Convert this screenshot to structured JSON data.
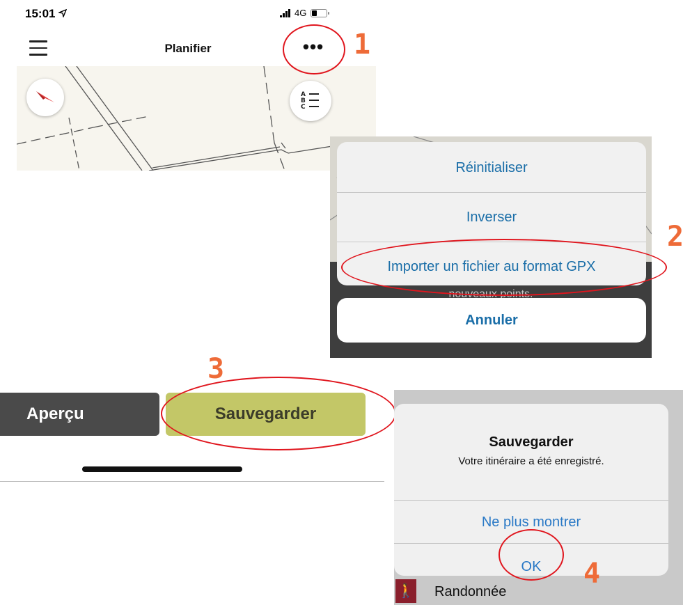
{
  "status_bar": {
    "time": "15:01",
    "network": "4G"
  },
  "header": {
    "title": "Planifier"
  },
  "action_sheet": {
    "items": [
      "Réinitialiser",
      "Inverser",
      "Importer un fichier au format GPX"
    ],
    "behind_text": "nouveaux points.",
    "cancel_label": "Annuler"
  },
  "bottom_bar": {
    "preview_label": "Aperçu",
    "save_label": "Sauvegarder"
  },
  "alert": {
    "title": "Sauvegarder",
    "message": "Votre itinéraire a été enregistré.",
    "dont_show_label": "Ne plus montrer",
    "ok_label": "OK"
  },
  "activity": {
    "label": "Randonnée"
  },
  "annotations": {
    "step1": "1",
    "step2": "2",
    "step3": "3",
    "step4": "4",
    "color": "#e0161e",
    "number_color": "#ee6b38"
  },
  "colors": {
    "save_button": "#c3c767",
    "preview_button": "#4a4a4a",
    "link_blue": "#2a79c6"
  }
}
